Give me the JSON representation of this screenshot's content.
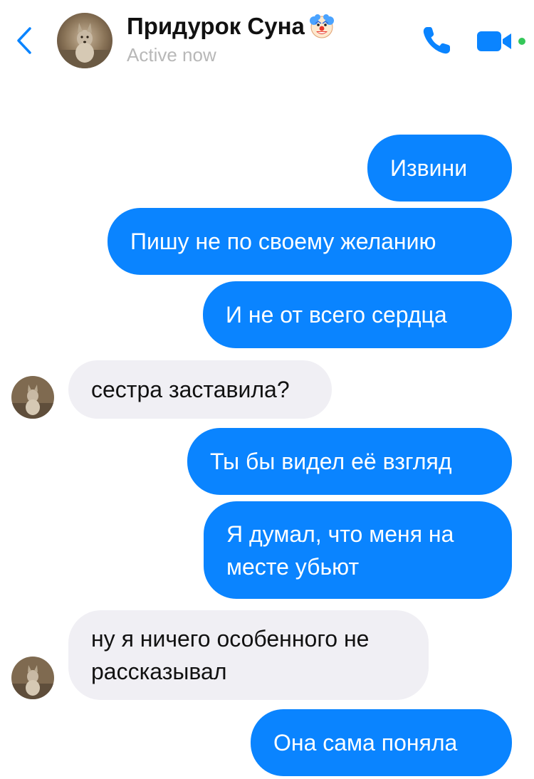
{
  "header": {
    "back_icon": "chevron-left-icon",
    "contact_name": "Придурок Суна",
    "name_emoji_icon": "clown-face-icon",
    "status": "Active now",
    "call_icon": "phone-icon",
    "video_icon": "video-camera-icon",
    "accent_color": "#0a84ff",
    "status_dot_color": "#34c759"
  },
  "messages": [
    {
      "direction": "outgoing",
      "text": "Извини"
    },
    {
      "direction": "outgoing",
      "text": "Пишу не по своему желанию"
    },
    {
      "direction": "outgoing",
      "text": "И не от всего сердца"
    },
    {
      "direction": "incoming",
      "text": "сестра заставила?"
    },
    {
      "direction": "outgoing",
      "text": "Ты бы видел её взгляд"
    },
    {
      "direction": "outgoing",
      "text": "Я думал, что меня на месте убьют"
    },
    {
      "direction": "incoming",
      "text": "ну я ничего особенного не рассказывал"
    },
    {
      "direction": "outgoing",
      "text": "Она сама поняла"
    }
  ],
  "colors": {
    "outgoing_bubble": "#0a84ff",
    "incoming_bubble": "#f0eff4"
  }
}
